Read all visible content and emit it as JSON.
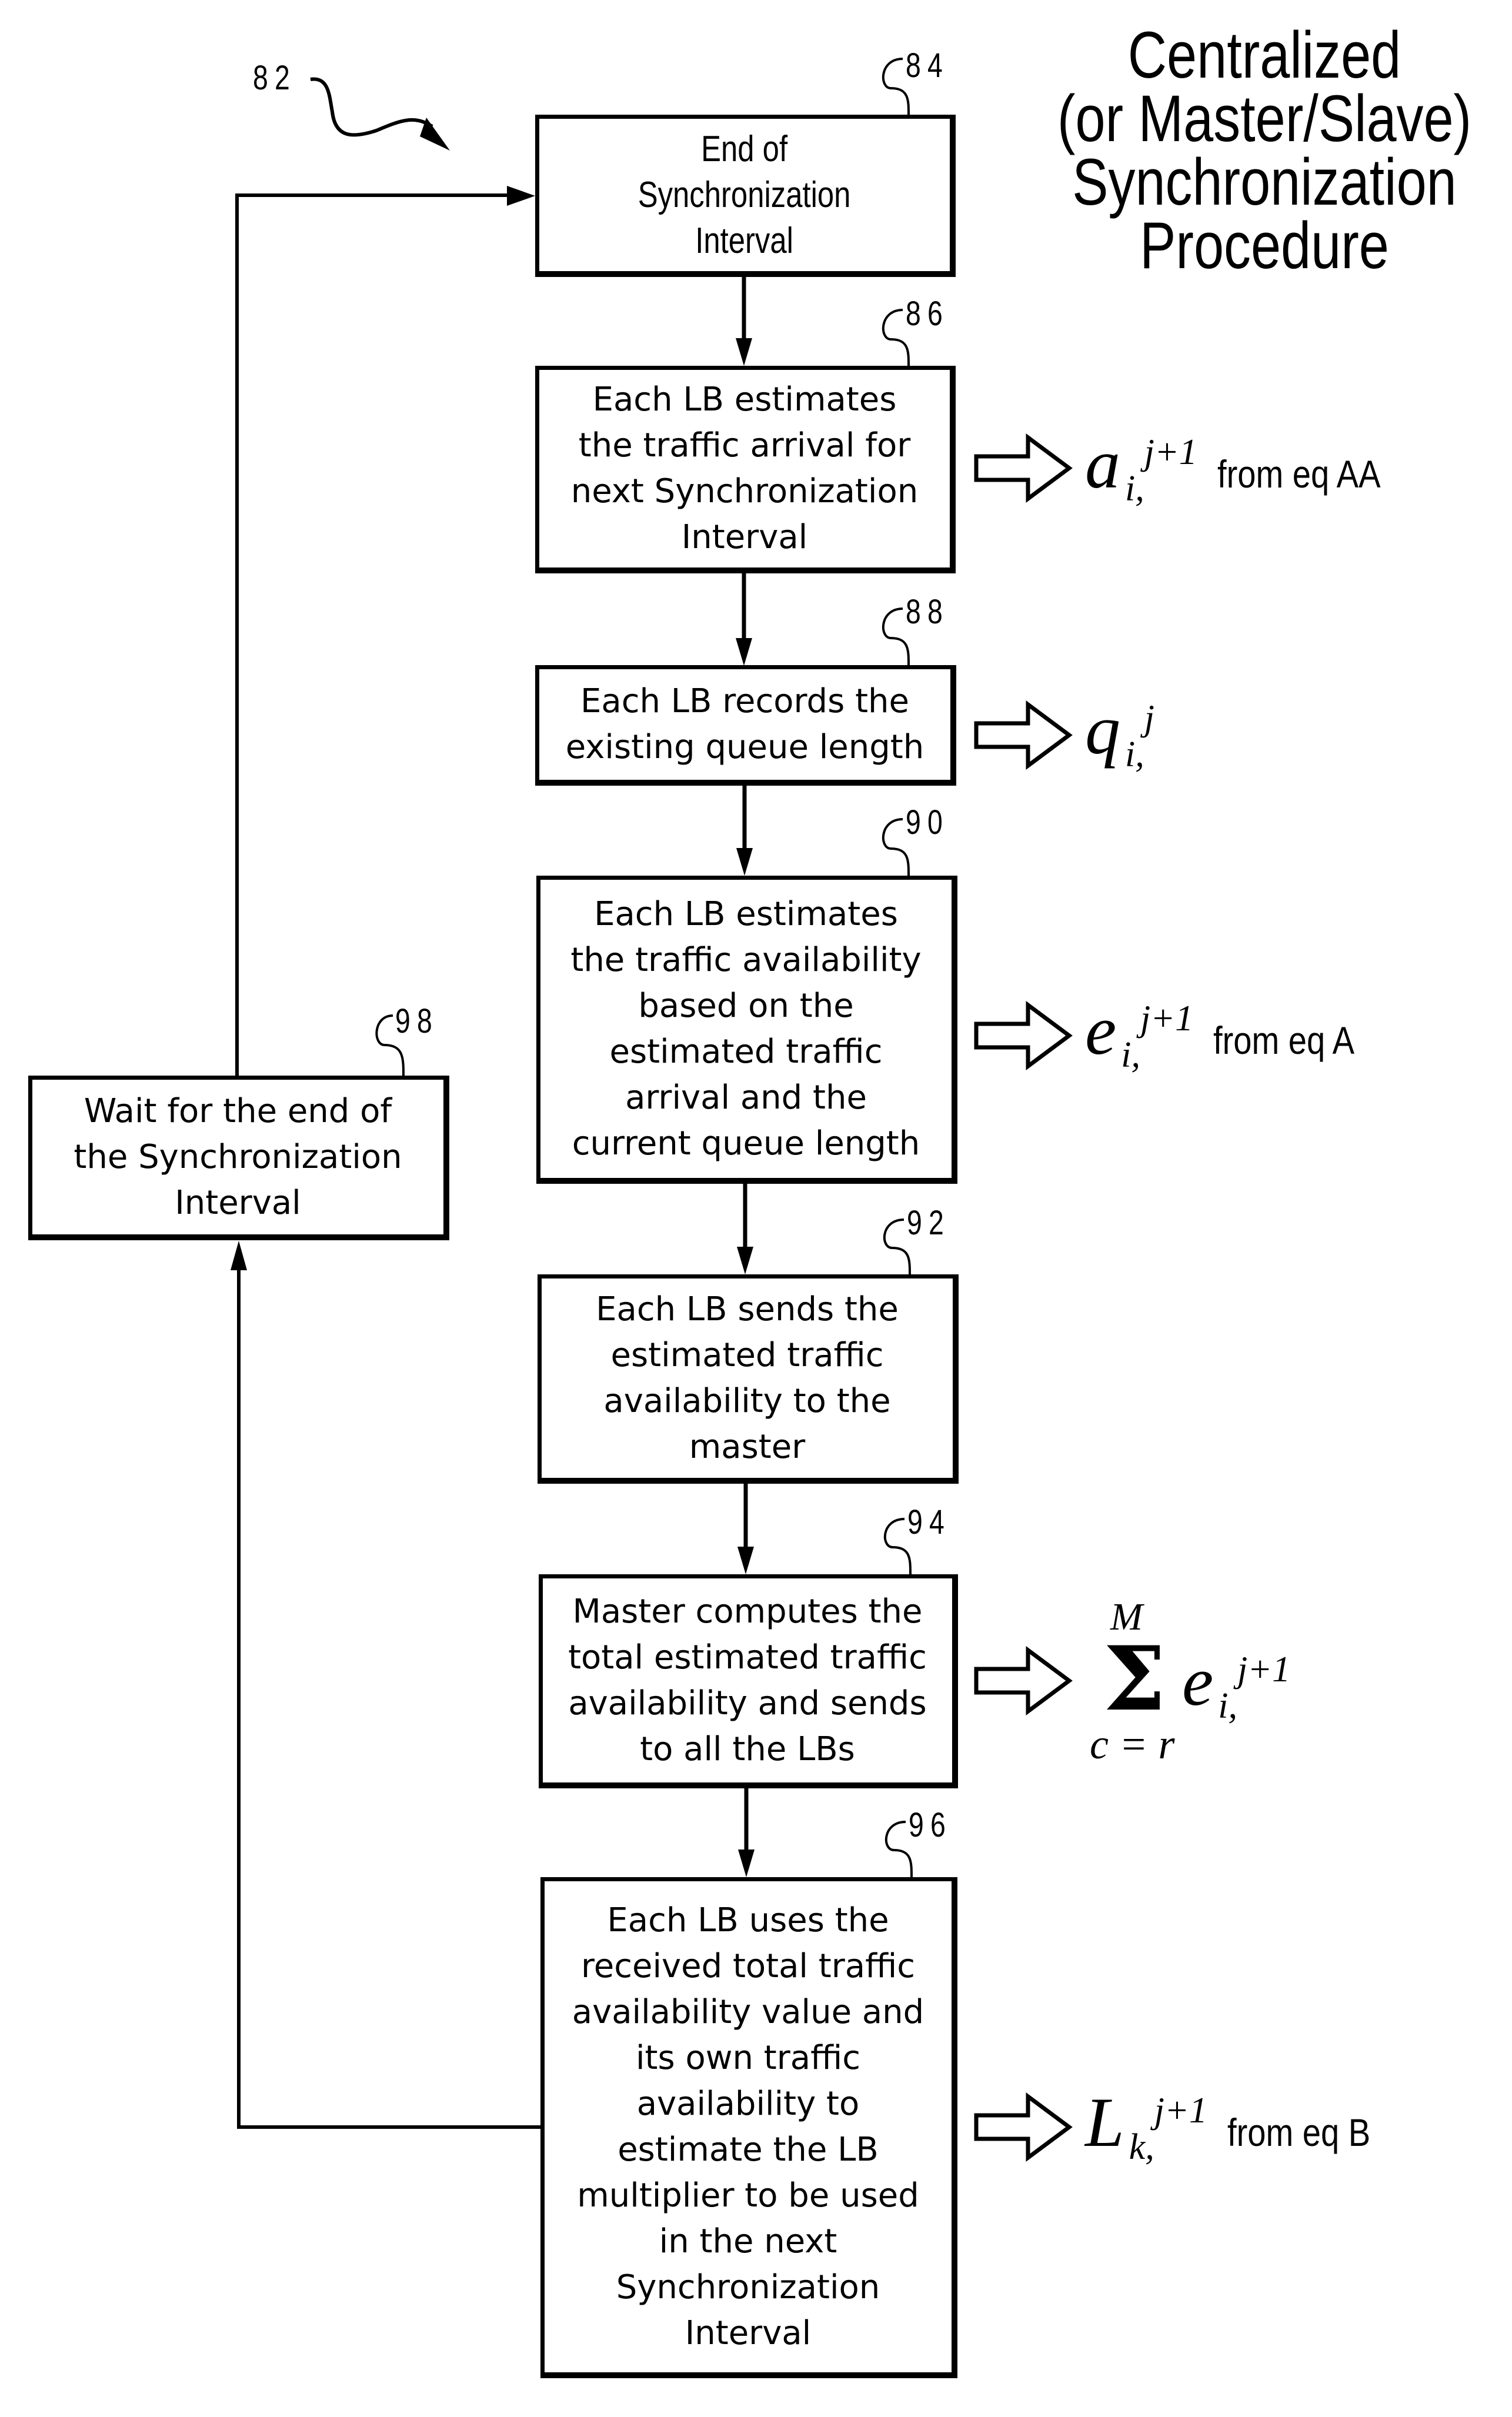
{
  "figure": {
    "reference_numeral": "82",
    "title": "Centralized\n(or Master/Slave)\nSynchronization\nProcedure"
  },
  "steps": [
    {
      "id": "84",
      "ref": "84",
      "text": "End of\nSynchronization\nInterval"
    },
    {
      "id": "86",
      "ref": "86",
      "text": "Each LB estimates\nthe traffic arrival for\nnext Synchronization\nInterval"
    },
    {
      "id": "88",
      "ref": "88",
      "text": "Each LB records the\nexisting queue length"
    },
    {
      "id": "90",
      "ref": "90",
      "text": "Each LB estimates\nthe traffic availability\nbased on the\nestimated traffic\narrival and the\ncurrent queue length"
    },
    {
      "id": "92",
      "ref": "92",
      "text": "Each LB sends the\nestimated traffic\navailability to the\nmaster"
    },
    {
      "id": "94",
      "ref": "94",
      "text": "Master computes the\ntotal estimated traffic\navailability and sends\nto all the LBs"
    },
    {
      "id": "96",
      "ref": "96",
      "text": "Each LB uses the\nreceived total traffic\navailability value and\nits own traffic\navailability to\nestimate the LB\nmultiplier to be used\nin the next\nSynchronization\nInterval"
    },
    {
      "id": "98",
      "ref": "98",
      "text": "Wait for the end of\nthe Synchronization\nInterval"
    }
  ],
  "outputs": {
    "arrival": {
      "symbol": "a",
      "sub": "i,",
      "sup": "j+1",
      "note": "from eq AA"
    },
    "queue": {
      "symbol": "q",
      "sub": "i,",
      "sup": "j",
      "note": ""
    },
    "availability": {
      "symbol": "e",
      "sub": "i,",
      "sup": "j+1",
      "note": "from eq A"
    },
    "total": {
      "upper": "M",
      "operator": "Σ",
      "lower": "c = r",
      "symbol": "e",
      "sub": "i,",
      "sup": "j+1"
    },
    "multiplier": {
      "symbol": "L",
      "sub": "k,",
      "sup": "j+1",
      "note": "from eq B"
    }
  }
}
